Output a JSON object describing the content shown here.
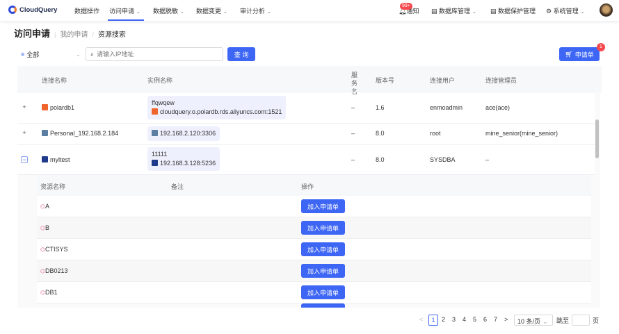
{
  "nav": {
    "logo": "CloudQuery",
    "items": [
      "数据操作",
      "访问申请",
      "数据脱敏",
      "数据变更",
      "审计分析"
    ],
    "notify": "通知",
    "notify_badge": "99+",
    "db_manage": "数据库管理",
    "data_protect": "数据保护管理",
    "sys_manage": "系统管理"
  },
  "breadcrumb": {
    "title": "访问申请",
    "sep1": "|",
    "item1": "我的申请",
    "sep2": "/",
    "item2": "资源搜索"
  },
  "filter": {
    "select": "全部",
    "placeholder": "请输入IP地址",
    "query": "查 询",
    "cart": "申请单",
    "cart_badge": "1"
  },
  "table": {
    "headers": [
      "连接名称",
      "实例名称",
      "服务名",
      "版本号",
      "连接用户",
      "连接管理员"
    ],
    "rows": [
      {
        "expand": "+",
        "name": "polardb1",
        "instance_name": "ffqwqew",
        "instance": "cloudquery.o.polardb.rds.aliyuncs.com:1521",
        "service": "–",
        "version": "1.6",
        "user": "enmoadmin",
        "admin": "ace(ace)"
      },
      {
        "expand": "+",
        "name": "Personal_192.168.2.184",
        "instance": "192.168.2.120:3306",
        "service": "–",
        "version": "8.0",
        "user": "root",
        "admin": "mine_senior(mine_senior)"
      },
      {
        "expand": "−",
        "name": "myltest",
        "instance_name": "11111",
        "instance": "192.168.3.128:5236",
        "service": "–",
        "version": "8.0",
        "user": "SYSDBA",
        "admin": "–"
      }
    ]
  },
  "sub": {
    "headers": [
      "资源名称",
      "备注",
      "操作"
    ],
    "action": "加入申请单",
    "rows": [
      "A",
      "B",
      "CTISYS",
      "DB0213",
      "DB1"
    ]
  },
  "pagination": {
    "prev": "<",
    "pages": [
      "1",
      "2",
      "3",
      "4",
      "5",
      "6",
      "7"
    ],
    "next": ">",
    "size": "10 条/页",
    "jump": "跳至",
    "page_suffix": "页"
  },
  "colors": {
    "primary": "#3d66f5",
    "badge": "#f5494d"
  }
}
